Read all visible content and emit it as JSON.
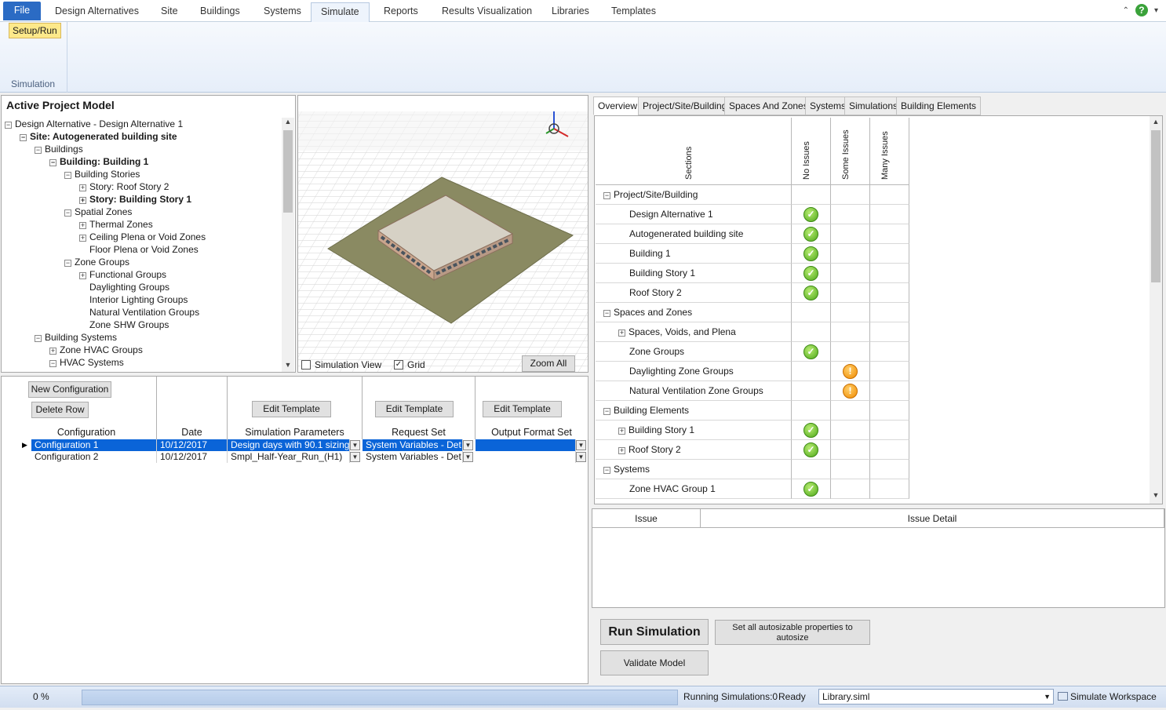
{
  "menu": {
    "tabs": [
      "File",
      "Design Alternatives",
      "Site",
      "Buildings",
      "Systems",
      "Simulate",
      "Reports",
      "Results Visualization",
      "Libraries",
      "Templates"
    ],
    "active": "Simulate"
  },
  "ribbon": {
    "setup_run": "Setup/Run",
    "group_label": "Simulation"
  },
  "tree": {
    "title": "Active Project Model",
    "items": [
      {
        "label": "Design Alternative - Design Alternative 1",
        "level": 0,
        "exp": "-",
        "bold": false
      },
      {
        "label": "Site: Autogenerated building site",
        "level": 1,
        "exp": "-",
        "bold": true
      },
      {
        "label": "Buildings",
        "level": 2,
        "exp": "-",
        "bold": false
      },
      {
        "label": "Building: Building  1",
        "level": 3,
        "exp": "-",
        "bold": true
      },
      {
        "label": "Building Stories",
        "level": 4,
        "exp": "-",
        "bold": false
      },
      {
        "label": "Story: Roof Story 2",
        "level": 5,
        "exp": "+",
        "bold": false
      },
      {
        "label": "Story: Building Story 1",
        "level": 5,
        "exp": "+",
        "bold": true
      },
      {
        "label": "Spatial Zones",
        "level": 4,
        "exp": "-",
        "bold": false
      },
      {
        "label": "Thermal Zones",
        "level": 5,
        "exp": "+",
        "bold": false
      },
      {
        "label": "Ceiling Plena or Void Zones",
        "level": 5,
        "exp": "+",
        "bold": false
      },
      {
        "label": "Floor Plena or Void Zones",
        "level": 5,
        "exp": "",
        "bold": false
      },
      {
        "label": "Zone Groups",
        "level": 4,
        "exp": "-",
        "bold": false
      },
      {
        "label": "Functional Groups",
        "level": 5,
        "exp": "+",
        "bold": false
      },
      {
        "label": "Daylighting Groups",
        "level": 5,
        "exp": "",
        "bold": false
      },
      {
        "label": "Interior Lighting Groups",
        "level": 5,
        "exp": "",
        "bold": false
      },
      {
        "label": "Natural Ventilation Groups",
        "level": 5,
        "exp": "",
        "bold": false
      },
      {
        "label": "Zone SHW Groups",
        "level": 5,
        "exp": "",
        "bold": false
      },
      {
        "label": "Building Systems",
        "level": 2,
        "exp": "-",
        "bold": false
      },
      {
        "label": "Zone HVAC Groups",
        "level": 3,
        "exp": "+",
        "bold": false
      },
      {
        "label": "HVAC Systems",
        "level": 3,
        "exp": "-",
        "bold": false
      }
    ]
  },
  "view3d": {
    "simulation_view": "Simulation View",
    "grid": "Grid",
    "zoom_all": "Zoom All",
    "simulation_view_checked": false,
    "grid_checked": true
  },
  "config": {
    "new_configuration": "New Configuration",
    "delete_row": "Delete Row",
    "edit_template": "Edit Template",
    "columns": [
      "Configuration",
      "Date",
      "Simulation Parameters",
      "Request Set",
      "Output Format Set"
    ],
    "rows": [
      {
        "name": "Configuration 1",
        "date": "10/12/2017",
        "params": "Design days with 90.1 sizing…",
        "request": "System Variables - Det…",
        "output": ""
      },
      {
        "name": "Configuration 2",
        "date": "10/12/2017",
        "params": "Smpl_Half-Year_Run_(H1)",
        "request": "System Variables - Det…",
        "output": ""
      }
    ]
  },
  "right_tabs": [
    "Overview",
    "Project/Site/Building",
    "Spaces And Zones",
    "Systems",
    "Simulations",
    "Building Elements"
  ],
  "overview": {
    "headers": [
      "Sections",
      "No Issues",
      "Some Issues",
      "Many Issues"
    ],
    "rows": [
      {
        "label": "Project/Site/Building",
        "group": true,
        "exp": "-",
        "status": ""
      },
      {
        "label": "Design Alternative 1",
        "group": false,
        "exp": "",
        "status": "ok"
      },
      {
        "label": "Autogenerated building site",
        "group": false,
        "exp": "",
        "status": "ok"
      },
      {
        "label": "Building  1",
        "group": false,
        "exp": "",
        "status": "ok"
      },
      {
        "label": "Building Story 1",
        "group": false,
        "exp": "",
        "status": "ok"
      },
      {
        "label": "Roof Story 2",
        "group": false,
        "exp": "",
        "status": "ok"
      },
      {
        "label": "Spaces and Zones",
        "group": true,
        "exp": "-",
        "status": ""
      },
      {
        "label": "Spaces, Voids, and Plena",
        "group": false,
        "exp": "+",
        "status": ""
      },
      {
        "label": "Zone Groups",
        "group": false,
        "exp": "",
        "status": "ok"
      },
      {
        "label": "Daylighting Zone Groups",
        "group": false,
        "exp": "",
        "status": "warn"
      },
      {
        "label": "Natural Ventilation Zone Groups",
        "group": false,
        "exp": "",
        "status": "warn"
      },
      {
        "label": "Building Elements",
        "group": true,
        "exp": "-",
        "status": ""
      },
      {
        "label": "Building Story 1",
        "group": false,
        "exp": "+",
        "status": "ok"
      },
      {
        "label": "Roof Story 2",
        "group": false,
        "exp": "+",
        "status": "ok"
      },
      {
        "label": "Systems",
        "group": true,
        "exp": "-",
        "status": ""
      },
      {
        "label": "Zone HVAC Group 1",
        "group": false,
        "exp": "",
        "status": "ok"
      }
    ]
  },
  "issues": {
    "col_issue": "Issue",
    "col_detail": "Issue Detail"
  },
  "actions": {
    "run_simulation": "Run Simulation",
    "autosize": "Set all autosizable properties to autosize",
    "validate": "Validate Model"
  },
  "status": {
    "progress": "0 %",
    "running": "Running Simulations:0",
    "ready": "Ready",
    "library": "Library.siml",
    "workspace": "Simulate Workspace"
  },
  "colors": {
    "accent": "#2b6bc4",
    "selected_row": "#0a64d8",
    "ok": "#4ea81a",
    "warn": "#f08a00"
  }
}
